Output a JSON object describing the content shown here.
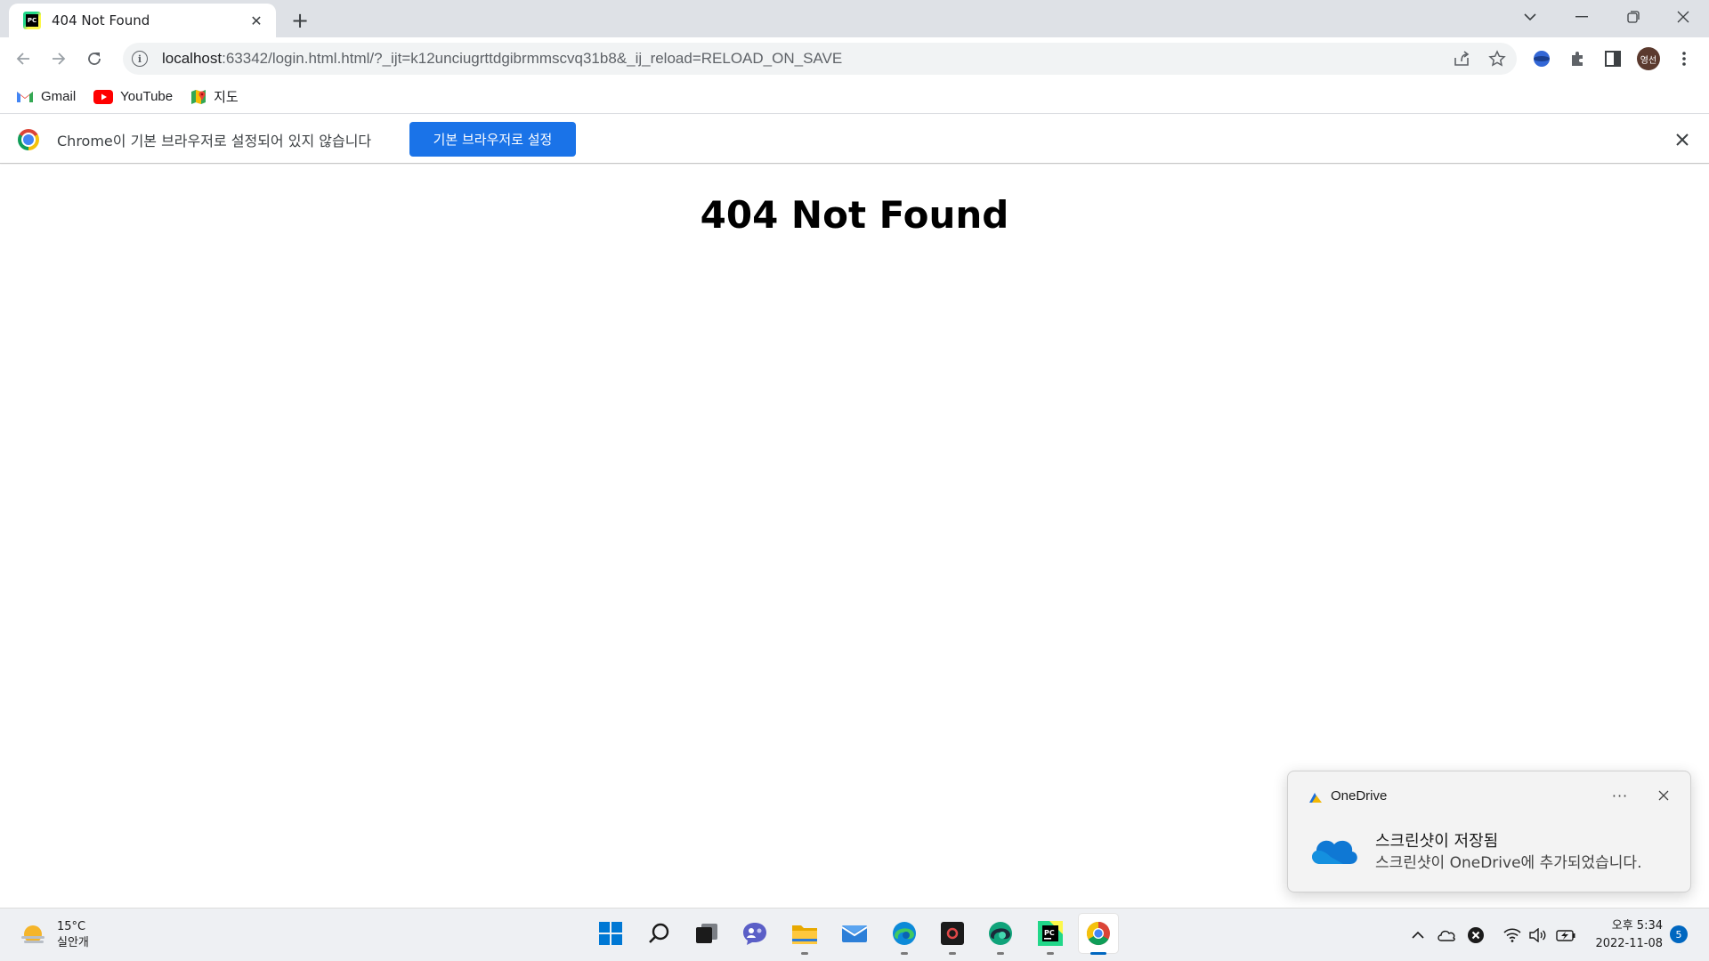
{
  "browser": {
    "tab": {
      "title": "404 Not Found",
      "close_glyph": "✕"
    },
    "new_tab_glyph": "+",
    "window_controls": {
      "tab_search_glyph": "⌄",
      "minimize_glyph": "—",
      "restore_glyph": "❐",
      "close_glyph": "✕"
    },
    "address_bar": {
      "url_host": "localhost",
      "url_rest": ":63342/login.html.html/?_ijt=k12unciugrttdgibrmmscvq31b8&_ij_reload=RELOAD_ON_SAVE"
    },
    "profile_avatar_text": "영선",
    "bookmarks": [
      {
        "label": "Gmail",
        "icon": "gmail-icon"
      },
      {
        "label": "YouTube",
        "icon": "youtube-icon"
      },
      {
        "label": "지도",
        "icon": "maps-icon"
      }
    ],
    "infobar": {
      "message": "Chrome이 기본 브라우저로 설정되어 있지 않습니다",
      "button_label": "기본 브라우저로 설정",
      "close_glyph": "✕"
    }
  },
  "page": {
    "heading": "404 Not Found"
  },
  "toast": {
    "app_name": "OneDrive",
    "more_glyph": "···",
    "close_glyph": "✕",
    "title": "스크린샷이 저장됨",
    "body": "스크린샷이 OneDrive에 추가되었습니다."
  },
  "taskbar": {
    "weather": {
      "temperature": "15°C",
      "condition": "실안개"
    },
    "apps": [
      {
        "name": "start",
        "icon": "windows-start-icon",
        "running": false
      },
      {
        "name": "search",
        "icon": "search-icon",
        "running": false
      },
      {
        "name": "task-view",
        "icon": "task-view-icon",
        "running": false
      },
      {
        "name": "chat",
        "icon": "chat-icon",
        "running": false
      },
      {
        "name": "file-explorer",
        "icon": "folder-icon",
        "running": true
      },
      {
        "name": "mail",
        "icon": "mail-icon",
        "running": false
      },
      {
        "name": "edge",
        "icon": "edge-icon",
        "running": true
      },
      {
        "name": "media-app",
        "icon": "record-icon",
        "running": true
      },
      {
        "name": "edge-dev",
        "icon": "edge-dev-icon",
        "running": true
      },
      {
        "name": "pycharm",
        "icon": "pycharm-icon",
        "running": true
      },
      {
        "name": "chrome",
        "icon": "chrome-icon",
        "running": true,
        "active": true
      }
    ],
    "clock": {
      "time": "오후 5:34",
      "date": "2022-11-08"
    },
    "notification_count": "5"
  },
  "colors": {
    "tabstrip_bg": "#dee1e6",
    "infobar_button": "#1a73e8",
    "taskbar_bg": "#eef0f3",
    "accent_blue": "#0067c0"
  }
}
